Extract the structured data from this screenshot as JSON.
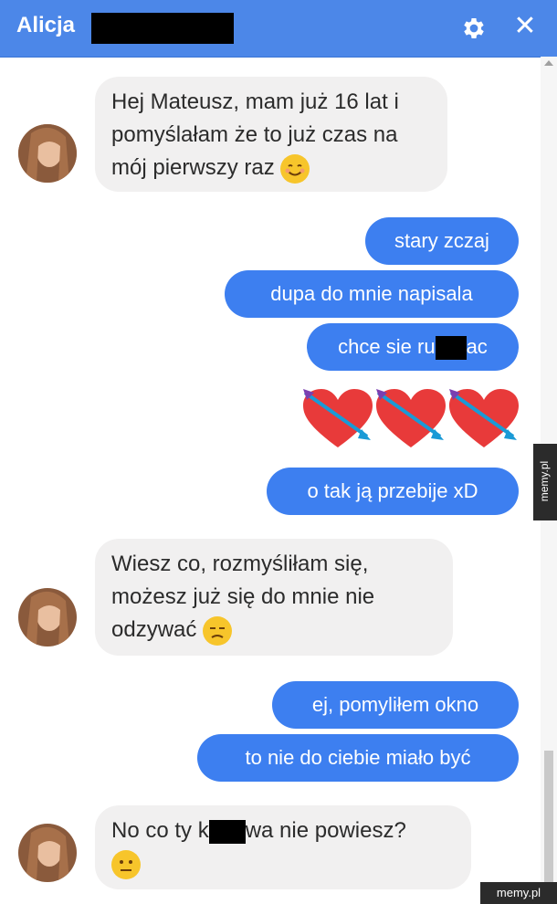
{
  "header": {
    "name": "Alicja",
    "settings_icon": "gear-icon",
    "close_icon": "close-icon",
    "background": "#4c87e8"
  },
  "messages": [
    {
      "from": "them",
      "text": "Hej Mateusz, mam już 16 lat i pomyślałam że to już czas na mój pierwszy raz",
      "emoji": "smiling-face-emoji"
    },
    {
      "from": "me",
      "text": "stary zczaj"
    },
    {
      "from": "me",
      "text": "dupa do mnie napisala"
    },
    {
      "from": "me",
      "text_before": "chce sie ru",
      "text_after": "ac"
    },
    {
      "from": "me",
      "sticker": "three-hearts-with-arrows"
    },
    {
      "from": "me",
      "text": "o tak ją przebije xD"
    },
    {
      "from": "them",
      "text": "Wiesz co, rozmyśliłam się, możesz już się do mnie nie odzywać",
      "emoji": "unamused-face-emoji"
    },
    {
      "from": "me",
      "text": "ej, pomyliłem okno"
    },
    {
      "from": "me",
      "text": "to nie do ciebie miało być"
    },
    {
      "from": "them",
      "text_before": "No co ty k",
      "text_after": "wa nie powiesz?",
      "emoji": "neutral-face-emoji"
    }
  ],
  "watermark": {
    "side": "memy.pl",
    "bottom": "memy.pl"
  },
  "colors": {
    "outgoing": "#3d7ff0",
    "incoming": "#f1f0f0"
  }
}
